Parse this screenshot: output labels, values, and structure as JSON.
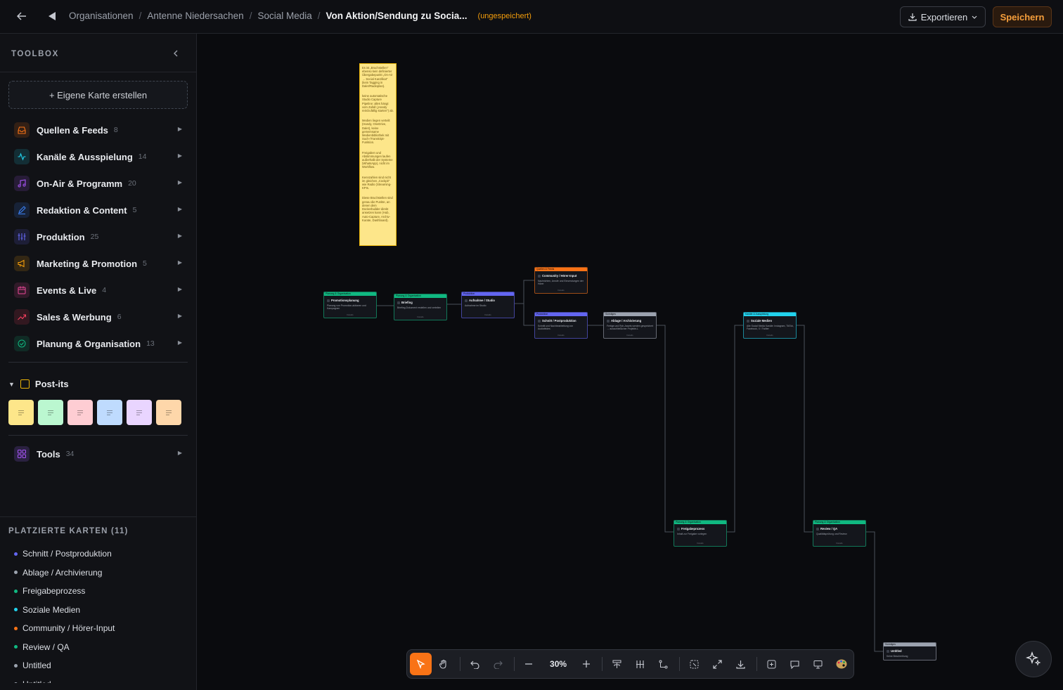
{
  "topbar": {
    "breadcrumbs": [
      "Organisationen",
      "Antenne Niedersachen",
      "Social Media"
    ],
    "current": "Von Aktion/Sendung zu Socia...",
    "status": "(ungespeichert)",
    "export_label": "Exportieren",
    "save_label": "Speichern"
  },
  "sidebar": {
    "title": "TOOLBOX",
    "create_card": "+ Eigene Karte erstellen",
    "categories": [
      {
        "label": "Quellen & Feeds",
        "count": "8",
        "icon": "inbox-icon",
        "color": "#f97316"
      },
      {
        "label": "Kanäle & Ausspielung",
        "count": "14",
        "icon": "activity-icon",
        "color": "#22d3ee"
      },
      {
        "label": "On-Air & Programm",
        "count": "20",
        "icon": "music-icon",
        "color": "#a855f7"
      },
      {
        "label": "Redaktion & Content",
        "count": "5",
        "icon": "pen-icon",
        "color": "#3b82f6"
      },
      {
        "label": "Produktion",
        "count": "25",
        "icon": "sliders-icon",
        "color": "#6366f1"
      },
      {
        "label": "Marketing & Promotion",
        "count": "5",
        "icon": "megaphone-icon",
        "color": "#f59e0b"
      },
      {
        "label": "Events & Live",
        "count": "4",
        "icon": "calendar-icon",
        "color": "#ec4899"
      },
      {
        "label": "Sales & Werbung",
        "count": "6",
        "icon": "trend-icon",
        "color": "#f43f5e"
      },
      {
        "label": "Planung & Organisation",
        "count": "13",
        "icon": "check-circle-icon",
        "color": "#10b981"
      }
    ],
    "postits_label": "Post-its",
    "postit_colors": [
      "#fde68a",
      "#bbf7d0",
      "#fecdd3",
      "#bfdbfe",
      "#e9d5ff",
      "#fed7aa"
    ],
    "tools_label": "Tools",
    "tools_count": "34",
    "placed_title": "PLATZIERTE KARTEN (11)",
    "placed": [
      {
        "label": "Schnitt / Postproduktion",
        "color": "#6366f1"
      },
      {
        "label": "Ablage / Archivierung",
        "color": "#9ca3af"
      },
      {
        "label": "Freigabeprozess",
        "color": "#10b981"
      },
      {
        "label": "Soziale Medien",
        "color": "#22d3ee"
      },
      {
        "label": "Community / Hörer-Input",
        "color": "#f97316"
      },
      {
        "label": "Review / QA",
        "color": "#10b981"
      },
      {
        "label": "Untitled",
        "color": "#9ca3af"
      },
      {
        "label": "Untitled",
        "color": "#9ca3af"
      }
    ]
  },
  "canvas": {
    "sticky_paragraphs": [
      "Es ist „Bruchstellen\" ebenso kein definierter Übergabepunkt „On-Air → Social Kanzlikat\" (kein Tagging in Dalet/Radioplan).",
      "keine automatische Studio Capture Pipeline: alles hängt vom Zufall („Handy rein/zufällig starten\") ab.",
      "Medien liegen verteilt (Handy, OneDrive, Dalet), keine gemeinsame Medienbibliothek mit Such-/Transkript-Funktion.",
      "Freigaben und Abstimmungen laufen außerhalb der Systeme (WhatsApp), nicht im Workflow.",
      "Kennzahlen sind nicht im gleichen „Cockpit\" wie Radio (Streaming-KPIs.",
      "Diese Bruchstellen sind genau die Punkte, an denen dein Dockerbuilder direkt ansetzen kann (Hub, Auto-Capture, Archiv-Kurate, Dashboard)."
    ],
    "nodes": [
      {
        "category": "Planung & Organisation",
        "title": "Promotionsplanung",
        "desc": "Planung von Promotion-aktionen und Kampagnen",
        "footer": "Details",
        "color": "#10b981"
      },
      {
        "category": "Planung & Organisation",
        "title": "Briefing",
        "desc": "Briefing-Dokument erstellen und verteilen",
        "footer": "Details",
        "color": "#10b981"
      },
      {
        "category": "Produktion",
        "title": "Aufnahme / Studio",
        "desc": "Aufnahme im Studio",
        "footer": "Details",
        "color": "#6366f1"
      },
      {
        "category": "Quellen & Feeds",
        "title": "Community / Hörer-Input",
        "desc": "Nachrichten, Anrufe und Einsendungen der Hörer",
        "footer": "Details",
        "color": "#f97316"
      },
      {
        "category": "Produktion",
        "title": "Schnitt / Postproduktion",
        "desc": "Schnitt und Nachbearbeitung von Audiofeldes",
        "footer": "Details",
        "color": "#6366f1"
      },
      {
        "category": "Sonstiges",
        "title": "Ablage / Archivierung",
        "desc": "Fertige und Roh-Assets werden gespeichert → ausschließlicher Projekte-L",
        "footer": "Details",
        "color": "#9ca3af"
      },
      {
        "category": "Kanäle & Ausspielung",
        "title": "Soziale Medien",
        "desc": "Alle Social Media Kanäle: Instagram, TikTok, Facebook, X / Twitter",
        "footer": "Details",
        "color": "#22d3ee"
      },
      {
        "category": "Planung & Organisation",
        "title": "Freigabeprozess",
        "desc": "Inhalt zur Freigabe vorlegen",
        "footer": "Details",
        "color": "#10b981"
      },
      {
        "category": "Planung & Organisation",
        "title": "Review / QA",
        "desc": "Qualitätsprüfung und Review",
        "footer": "Details",
        "color": "#10b981"
      },
      {
        "category": "Sonstiges",
        "title": "Untitled",
        "desc": "Keine Beschreibung",
        "footer": "",
        "color": "#9ca3af"
      }
    ]
  },
  "toolbar": {
    "zoom": "30%"
  }
}
